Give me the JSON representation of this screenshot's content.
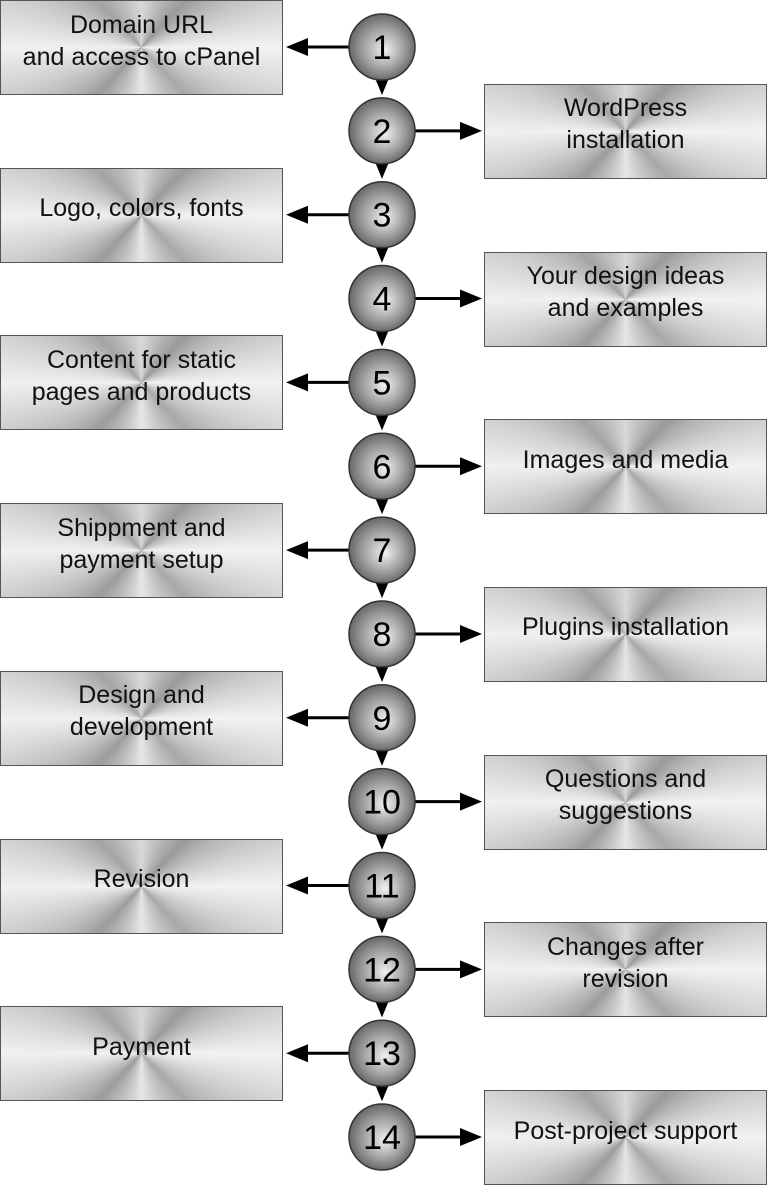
{
  "steps": [
    {
      "number": "1",
      "label": "Domain URL\nand access to cPanel",
      "side": "left"
    },
    {
      "number": "2",
      "label": "WordPress\ninstallation",
      "side": "right"
    },
    {
      "number": "3",
      "label": "Logo, colors, fonts",
      "side": "left"
    },
    {
      "number": "4",
      "label": "Your design ideas\nand examples",
      "side": "right"
    },
    {
      "number": "5",
      "label": "Content for static\npages and products",
      "side": "left"
    },
    {
      "number": "6",
      "label": "Images and media",
      "side": "right"
    },
    {
      "number": "7",
      "label": "Shippment and\npayment setup",
      "side": "left"
    },
    {
      "number": "8",
      "label": "Plugins installation",
      "side": "right"
    },
    {
      "number": "9",
      "label": "Design and\ndevelopment",
      "side": "left"
    },
    {
      "number": "10",
      "label": "Questions and\nsuggestions",
      "side": "right"
    },
    {
      "number": "11",
      "label": "Revision",
      "side": "left"
    },
    {
      "number": "12",
      "label": "Changes after\nrevision",
      "side": "right"
    },
    {
      "number": "13",
      "label": "Payment",
      "side": "left"
    },
    {
      "number": "14",
      "label": "Post-project support",
      "side": "right"
    }
  ]
}
